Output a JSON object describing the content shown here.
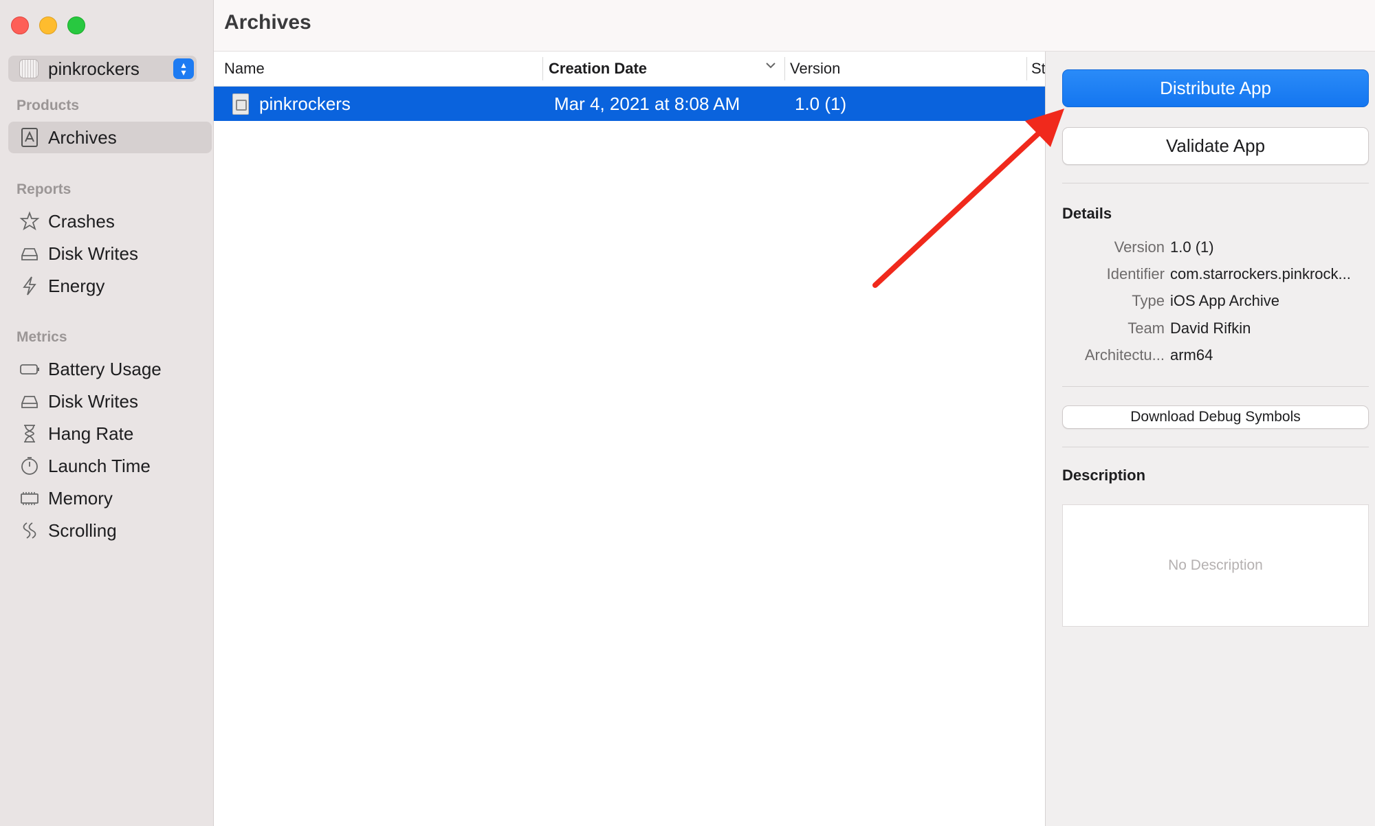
{
  "window": {
    "title": "Archives",
    "traffic_lights": [
      "close",
      "minimize",
      "zoom"
    ]
  },
  "sidebar": {
    "scheme": {
      "label": "pinkrockers",
      "icon": "app-icon"
    },
    "sections": [
      {
        "title": "Products",
        "items": [
          {
            "label": "Archives",
            "icon": "archive-icon",
            "selected": true
          }
        ]
      },
      {
        "title": "Reports",
        "items": [
          {
            "label": "Crashes",
            "icon": "crash-star-icon"
          },
          {
            "label": "Disk Writes",
            "icon": "disk-icon"
          },
          {
            "label": "Energy",
            "icon": "bolt-icon"
          }
        ]
      },
      {
        "title": "Metrics",
        "items": [
          {
            "label": "Battery Usage",
            "icon": "battery-icon"
          },
          {
            "label": "Disk Writes",
            "icon": "disk-icon"
          },
          {
            "label": "Hang Rate",
            "icon": "hourglass-icon"
          },
          {
            "label": "Launch Time",
            "icon": "stopwatch-icon"
          },
          {
            "label": "Memory",
            "icon": "memory-chip-icon"
          },
          {
            "label": "Scrolling",
            "icon": "scrolling-icon"
          }
        ]
      }
    ]
  },
  "table": {
    "columns": [
      "Name",
      "Creation Date",
      "Version",
      "St"
    ],
    "sorted_column": "Creation Date",
    "rows": [
      {
        "name": "pinkrockers",
        "creation_date": "Mar 4, 2021 at 8:08 AM",
        "version": "1.0 (1)",
        "selected": true
      }
    ]
  },
  "inspector": {
    "distribute_label": "Distribute App",
    "validate_label": "Validate App",
    "details_heading": "Details",
    "details": [
      {
        "label": "Version",
        "value": "1.0 (1)"
      },
      {
        "label": "Identifier",
        "value": "com.starrockers.pinkrock..."
      },
      {
        "label": "Type",
        "value": "iOS App Archive"
      },
      {
        "label": "Team",
        "value": "David Rifkin"
      },
      {
        "label": "Architectu...",
        "value": "arm64"
      }
    ],
    "debug_symbols_label": "Download Debug Symbols",
    "description_heading": "Description",
    "description_placeholder": "No Description"
  },
  "colors": {
    "accent": "#1476f0",
    "selection": "#0a63dd",
    "sidebar_bg": "#e9e4e4",
    "annotation_arrow": "#f0291c"
  }
}
